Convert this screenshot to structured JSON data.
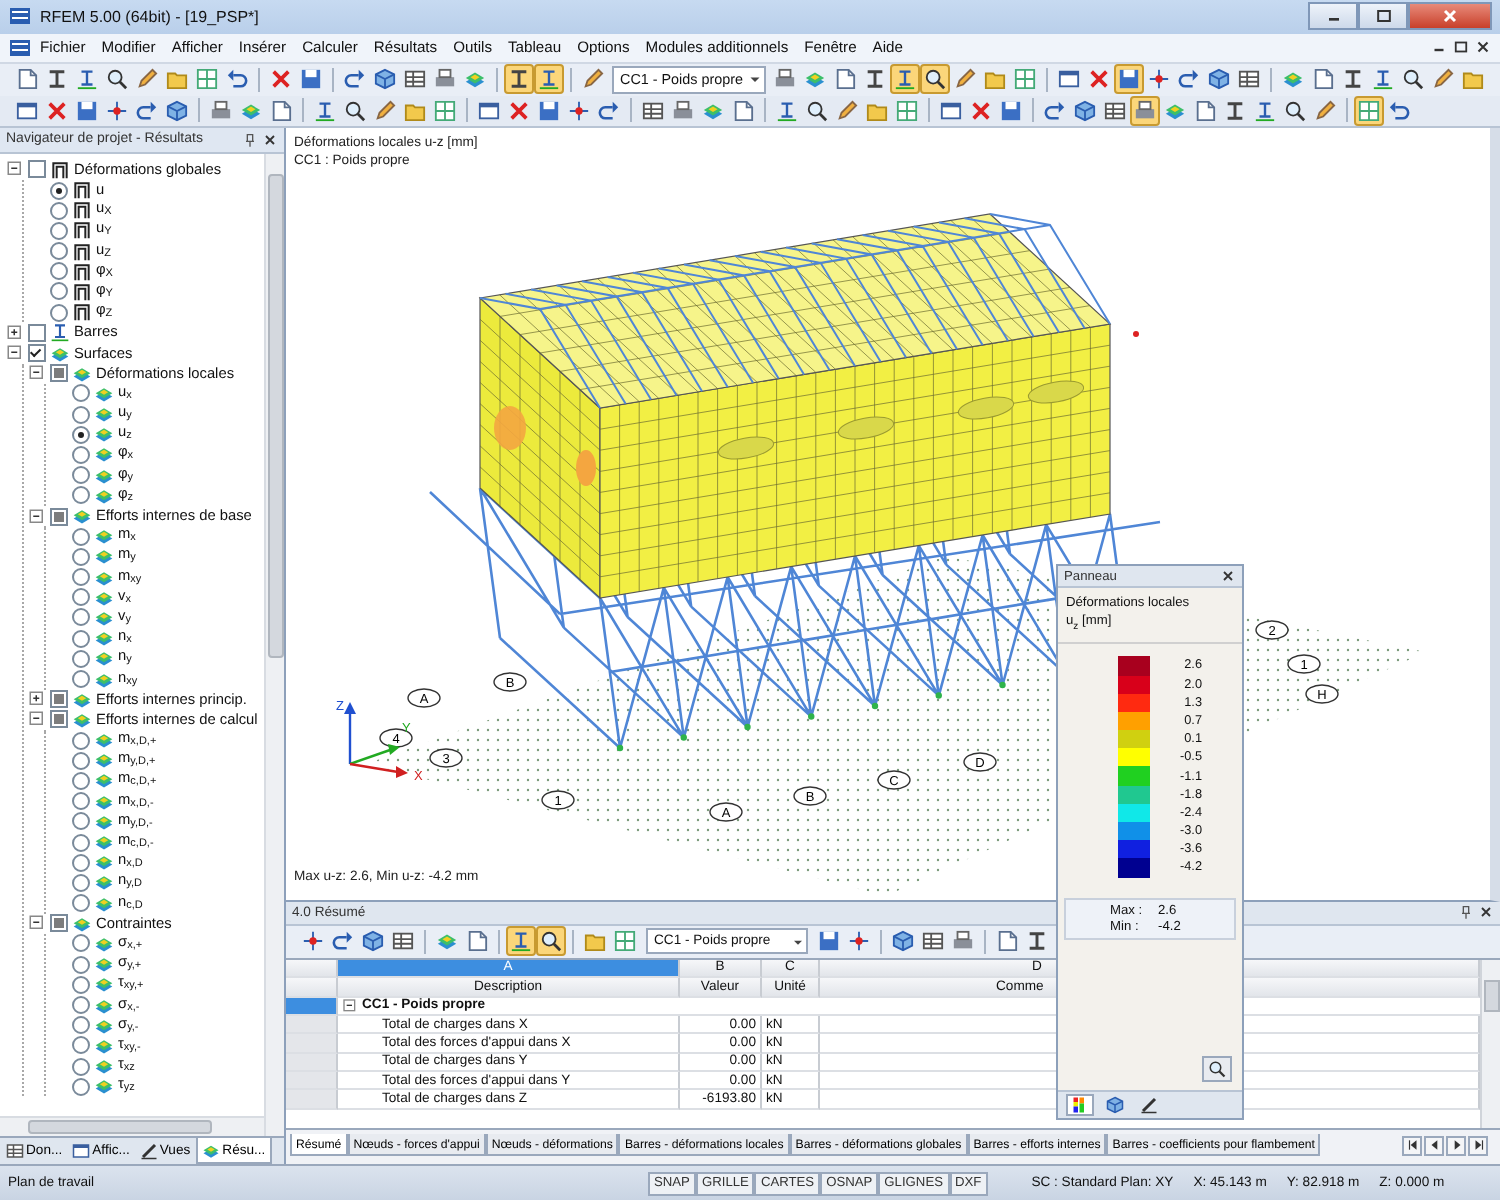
{
  "window": {
    "title": "RFEM 5.00 (64bit) - [19_PSP*]"
  },
  "menu": [
    "Fichier",
    "Modifier",
    "Afficher",
    "Insérer",
    "Calculer",
    "Résultats",
    "Outils",
    "Tableau",
    "Options",
    "Modules additionnels",
    "Fenêtre",
    "Aide"
  ],
  "toolbar_1": {
    "left": [
      {
        "kind": "button",
        "on": false
      },
      {
        "kind": "button",
        "on": false
      },
      {
        "kind": "button",
        "on": false
      },
      {
        "kind": "button",
        "on": false
      },
      {
        "kind": "button",
        "on": false
      },
      {
        "kind": "button",
        "on": false
      },
      {
        "kind": "button",
        "on": false
      },
      {
        "kind": "button",
        "on": false
      },
      {
        "kind": "separator"
      },
      {
        "kind": "button",
        "on": false
      },
      {
        "kind": "button",
        "on": false
      },
      {
        "kind": "separator"
      },
      {
        "kind": "button",
        "on": false
      },
      {
        "kind": "button",
        "on": false
      },
      {
        "kind": "button",
        "on": false
      },
      {
        "kind": "button",
        "on": false
      },
      {
        "kind": "button",
        "on": false
      },
      {
        "kind": "separator"
      },
      {
        "kind": "button",
        "on": true
      },
      {
        "kind": "button",
        "on": true
      },
      {
        "kind": "separator"
      },
      {
        "kind": "button",
        "on": false
      }
    ],
    "combo": "CC1 - Poids propre",
    "right": [
      {
        "kind": "button",
        "on": false
      },
      {
        "kind": "button",
        "on": false
      },
      {
        "kind": "button",
        "on": false
      },
      {
        "kind": "button",
        "on": false
      },
      {
        "kind": "button",
        "on": true
      },
      {
        "kind": "button",
        "on": true
      },
      {
        "kind": "button",
        "on": false
      },
      {
        "kind": "button",
        "on": false
      },
      {
        "kind": "button",
        "on": false
      },
      {
        "kind": "separator"
      },
      {
        "kind": "button",
        "on": false
      },
      {
        "kind": "button",
        "on": false
      },
      {
        "kind": "button",
        "on": true
      },
      {
        "kind": "button",
        "on": false
      },
      {
        "kind": "button",
        "on": false
      },
      {
        "kind": "button",
        "on": false
      },
      {
        "kind": "button",
        "on": false
      },
      {
        "kind": "separator"
      },
      {
        "kind": "button",
        "on": false
      },
      {
        "kind": "button",
        "on": false
      },
      {
        "kind": "button",
        "on": false
      },
      {
        "kind": "button",
        "on": false
      },
      {
        "kind": "button",
        "on": false
      },
      {
        "kind": "button",
        "on": false
      },
      {
        "kind": "button",
        "on": false
      }
    ]
  },
  "toolbar_2": [
    {
      "kind": "button",
      "on": false
    },
    {
      "kind": "button",
      "on": false
    },
    {
      "kind": "button",
      "on": false
    },
    {
      "kind": "button",
      "on": false
    },
    {
      "kind": "button",
      "on": false
    },
    {
      "kind": "button",
      "on": false
    },
    {
      "kind": "separator"
    },
    {
      "kind": "button",
      "on": false
    },
    {
      "kind": "button",
      "on": false
    },
    {
      "kind": "button",
      "on": false
    },
    {
      "kind": "separator"
    },
    {
      "kind": "button",
      "on": false
    },
    {
      "kind": "button",
      "on": false
    },
    {
      "kind": "button",
      "on": false
    },
    {
      "kind": "button",
      "on": false
    },
    {
      "kind": "button",
      "on": false
    },
    {
      "kind": "separator"
    },
    {
      "kind": "button",
      "on": false
    },
    {
      "kind": "button",
      "on": false
    },
    {
      "kind": "button",
      "on": false
    },
    {
      "kind": "button",
      "on": false
    },
    {
      "kind": "button",
      "on": false
    },
    {
      "kind": "separator"
    },
    {
      "kind": "button",
      "on": false
    },
    {
      "kind": "button",
      "on": false
    },
    {
      "kind": "button",
      "on": false
    },
    {
      "kind": "button",
      "on": false
    },
    {
      "kind": "separator"
    },
    {
      "kind": "button",
      "on": false
    },
    {
      "kind": "button",
      "on": false
    },
    {
      "kind": "button",
      "on": false
    },
    {
      "kind": "button",
      "on": false
    },
    {
      "kind": "button",
      "on": false
    },
    {
      "kind": "separator"
    },
    {
      "kind": "button",
      "on": false
    },
    {
      "kind": "button",
      "on": false
    },
    {
      "kind": "button",
      "on": false
    },
    {
      "kind": "separator"
    },
    {
      "kind": "button",
      "on": false
    },
    {
      "kind": "button",
      "on": false
    },
    {
      "kind": "button",
      "on": false
    },
    {
      "kind": "button",
      "on": true
    },
    {
      "kind": "button",
      "on": false
    },
    {
      "kind": "button",
      "on": false
    },
    {
      "kind": "button",
      "on": false
    },
    {
      "kind": "button",
      "on": false
    },
    {
      "kind": "button",
      "on": false
    },
    {
      "kind": "button",
      "on": false
    },
    {
      "kind": "separator"
    },
    {
      "kind": "button",
      "on": true
    },
    {
      "kind": "button",
      "on": false
    }
  ],
  "navigator": {
    "title": "Navigateur de projet - Résultats",
    "tree": [
      {
        "label": "Déformations globales",
        "kind": "check",
        "checked": false,
        "expanded": true,
        "children": [
          {
            "label": "u",
            "kind": "radio",
            "selected": true
          },
          {
            "label": "u$_{X}$",
            "kind": "radio",
            "selected": false
          },
          {
            "label": "u$_{Y}$",
            "kind": "radio",
            "selected": false
          },
          {
            "label": "u$_{Z}$",
            "kind": "radio",
            "selected": false
          },
          {
            "label": "φ$_{X}$",
            "kind": "radio",
            "selected": false
          },
          {
            "label": "φ$_{Y}$",
            "kind": "radio",
            "selected": false
          },
          {
            "label": "φ$_{Z}$",
            "kind": "radio",
            "selected": false
          }
        ]
      },
      {
        "label": "Barres",
        "kind": "check",
        "checked": false,
        "expanded": false
      },
      {
        "label": "Surfaces",
        "kind": "check",
        "checked": true,
        "expanded": true,
        "children": [
          {
            "label": "Déformations locales",
            "kind": "check",
            "checked": true,
            "partial": true,
            "expanded": true,
            "children": [
              {
                "label": "u$_{x}$",
                "kind": "radio",
                "selected": false
              },
              {
                "label": "u$_{y}$",
                "kind": "radio",
                "selected": false
              },
              {
                "label": "u$_{z}$",
                "kind": "radio",
                "selected": true
              },
              {
                "label": "φ$_{x}$",
                "kind": "radio",
                "selected": false
              },
              {
                "label": "φ$_{y}$",
                "kind": "radio",
                "selected": false
              },
              {
                "label": "φ$_{z}$",
                "kind": "radio",
                "selected": false
              }
            ]
          },
          {
            "label": "Efforts internes de base",
            "kind": "check",
            "checked": true,
            "partial": true,
            "expanded": true,
            "children": [
              {
                "label": "m$_{x}$",
                "kind": "radio",
                "selected": false
              },
              {
                "label": "m$_{y}$",
                "kind": "radio",
                "selected": false
              },
              {
                "label": "m$_{xy}$",
                "kind": "radio",
                "selected": false
              },
              {
                "label": "v$_{x}$",
                "kind": "radio",
                "selected": false
              },
              {
                "label": "v$_{y}$",
                "kind": "radio",
                "selected": false
              },
              {
                "label": "n$_{x}$",
                "kind": "radio",
                "selected": false
              },
              {
                "label": "n$_{y}$",
                "kind": "radio",
                "selected": false
              },
              {
                "label": "n$_{xy}$",
                "kind": "radio",
                "selected": false
              }
            ]
          },
          {
            "label": "Efforts internes princip.",
            "kind": "check",
            "checked": true,
            "partial": true,
            "expanded": false
          },
          {
            "label": "Efforts internes de calcul",
            "kind": "check",
            "checked": true,
            "partial": true,
            "expanded": true,
            "children": [
              {
                "label": "m$_{x,D,+}$",
                "kind": "radio",
                "selected": false
              },
              {
                "label": "m$_{y,D,+}$",
                "kind": "radio",
                "selected": false
              },
              {
                "label": "m$_{c,D,+}$",
                "kind": "radio",
                "selected": false
              },
              {
                "label": "m$_{x,D,-}$",
                "kind": "radio",
                "selected": false
              },
              {
                "label": "m$_{y,D,-}$",
                "kind": "radio",
                "selected": false
              },
              {
                "label": "m$_{c,D,-}$",
                "kind": "radio",
                "selected": false
              },
              {
                "label": "n$_{x,D}$",
                "kind": "radio",
                "selected": false
              },
              {
                "label": "n$_{y,D}$",
                "kind": "radio",
                "selected": false
              },
              {
                "label": "n$_{c,D}$",
                "kind": "radio",
                "selected": false
              }
            ]
          },
          {
            "label": "Contraintes",
            "kind": "check",
            "checked": true,
            "partial": true,
            "expanded": true,
            "children": [
              {
                "label": "σ$_{x,+}$",
                "kind": "radio",
                "selected": false
              },
              {
                "label": "σ$_{y,+}$",
                "kind": "radio",
                "selected": false
              },
              {
                "label": "τ$_{xy,+}$",
                "kind": "radio",
                "selected": false
              },
              {
                "label": "σ$_{x,-}$",
                "kind": "radio",
                "selected": false
              },
              {
                "label": "σ$_{y,-}$",
                "kind": "radio",
                "selected": false
              },
              {
                "label": "τ$_{xy,-}$",
                "kind": "radio",
                "selected": false
              },
              {
                "label": "τ$_{xz}$",
                "kind": "radio",
                "selected": false
              },
              {
                "label": "τ$_{yz}$",
                "kind": "radio",
                "selected": false
              }
            ]
          }
        ]
      }
    ],
    "tabs": [
      {
        "label": "Don...",
        "selected": false
      },
      {
        "label": "Affic...",
        "selected": false
      },
      {
        "label": "Vues",
        "selected": false
      },
      {
        "label": "Résu...",
        "selected": true
      }
    ]
  },
  "viewport": {
    "heading": "Déformations locales u-z [mm]",
    "subheading": "CC1 : Poids propre",
    "footer": "Max u-z: 2.6, Min u-z: -4.2 mm",
    "axis_labels": [
      "A",
      "B",
      "4",
      "3",
      "1",
      "A",
      "B",
      "C",
      "D",
      "2",
      "1",
      "H"
    ],
    "triad_labels": [
      "X",
      "Y",
      "Z"
    ]
  },
  "results": {
    "title": "4.0 Résumé",
    "toolbar": [
      {
        "kind": "button",
        "on": false
      },
      {
        "kind": "button",
        "on": false
      },
      {
        "kind": "button",
        "on": false
      },
      {
        "kind": "button",
        "on": false
      },
      {
        "kind": "separator"
      },
      {
        "kind": "button",
        "on": false
      },
      {
        "kind": "button",
        "on": false
      },
      {
        "kind": "separator"
      },
      {
        "kind": "button",
        "on": true
      },
      {
        "kind": "button",
        "on": true
      },
      {
        "kind": "separator"
      },
      {
        "kind": "button",
        "on": false
      },
      {
        "kind": "button",
        "on": false
      }
    ],
    "combo": "CC1 - Poids propre",
    "toolbar_right": [
      {
        "kind": "button",
        "on": false
      },
      {
        "kind": "button",
        "on": false
      },
      {
        "kind": "separator"
      },
      {
        "kind": "button",
        "on": false
      },
      {
        "kind": "button",
        "on": false
      },
      {
        "kind": "button",
        "on": false
      },
      {
        "kind": "separator"
      },
      {
        "kind": "button",
        "on": false
      },
      {
        "kind": "button",
        "on": false
      }
    ],
    "column_letters": [
      {
        "label": "A",
        "selected": true
      },
      {
        "label": "B",
        "selected": false
      },
      {
        "label": "C",
        "selected": false
      },
      {
        "label": "D",
        "selected": false
      }
    ],
    "columns": [
      "Description",
      "Valeur",
      "Unité",
      "Comme"
    ],
    "group": {
      "label": "CC1 - Poids propre",
      "expanded": true,
      "selected": true
    },
    "rows": [
      {
        "description": "Total de charges dans X",
        "value": "0.00",
        "unit": "kN",
        "selected": false
      },
      {
        "description": "Total des forces d'appui dans X",
        "value": "0.00",
        "unit": "kN",
        "selected": false
      },
      {
        "description": "Total de charges dans Y",
        "value": "0.00",
        "unit": "kN",
        "selected": false
      },
      {
        "description": "Total des forces d'appui dans Y",
        "value": "0.00",
        "unit": "kN",
        "selected": false
      },
      {
        "description": "Total de charges dans Z",
        "value": "-6193.80",
        "unit": "kN",
        "selected": false
      }
    ],
    "tabs": [
      {
        "label": "Résumé",
        "selected": true
      },
      {
        "label": "Nœuds - forces d'appui",
        "selected": false
      },
      {
        "label": "Nœuds - déformations",
        "selected": false
      },
      {
        "label": "Barres - déformations locales",
        "selected": false
      },
      {
        "label": "Barres - déformations globales",
        "selected": false
      },
      {
        "label": "Barres - efforts internes",
        "selected": false
      },
      {
        "label": "Barres - coefficients pour flambement",
        "selected": false
      }
    ]
  },
  "panel": {
    "title": "Panneau",
    "heading": "Déformations locales",
    "unit": "u$_{z}$ [mm]",
    "legend": [
      {
        "value": "2.6",
        "color": "#a8001e"
      },
      {
        "value": "2.0",
        "color": "#d8001a"
      },
      {
        "value": "1.3",
        "color": "#ff2a10"
      },
      {
        "value": "0.7",
        "color": "#ffa000"
      },
      {
        "value": "0.1",
        "color": "#d0d010"
      },
      {
        "value": "-0.5",
        "color": "#ffff00"
      },
      {
        "value": "-1.1",
        "color": "#20d020"
      },
      {
        "value": "-1.8",
        "color": "#20c890"
      },
      {
        "value": "-2.4",
        "color": "#10e8e8"
      },
      {
        "value": "-3.0",
        "color": "#1090e8"
      },
      {
        "value": "-3.6",
        "color": "#1020e0"
      },
      {
        "value": "-4.2",
        "color": "#000090"
      }
    ],
    "max_label": "Max :",
    "max": "2.6",
    "min_label": "Min :",
    "min": "-4.2",
    "tabs": [
      {
        "selected": true
      },
      {
        "selected": false
      },
      {
        "selected": false
      }
    ]
  },
  "status_bar": {
    "left": "Plan de travail",
    "toggles": [
      {
        "label": "SNAP",
        "on": false
      },
      {
        "label": "GRILLE",
        "on": false
      },
      {
        "label": "CARTES",
        "on": false
      },
      {
        "label": "OSNAP",
        "on": false
      },
      {
        "label": "GLIGNES",
        "on": false
      },
      {
        "label": "DXF",
        "on": false
      }
    ],
    "info": [
      "SC : Standard Plan: XY",
      "X: 45.143 m",
      "Y: 82.918 m",
      "Z: 0.000 m"
    ]
  }
}
